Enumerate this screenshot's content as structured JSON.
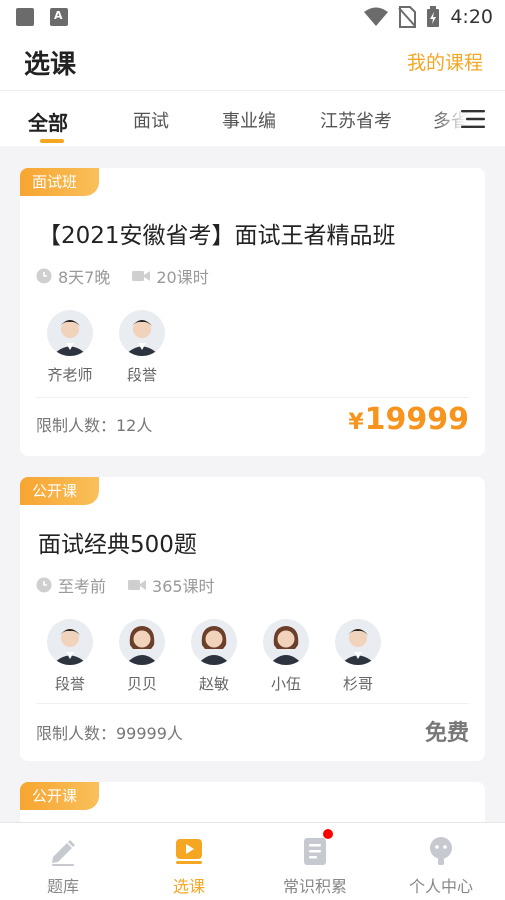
{
  "status_bar": {
    "time": "4:20"
  },
  "header": {
    "title": "选课",
    "my_courses": "我的课程"
  },
  "tabs": [
    "全部",
    "面试",
    "事业编",
    "江苏省考",
    "多省"
  ],
  "courses": [
    {
      "tag": "面试班",
      "title": "【2021安徽省考】面试王者精品班",
      "duration": "8天7晚",
      "lessons": "20课时",
      "teachers": [
        {
          "name": "齐老师",
          "avatar": "male-teacher-avatar"
        },
        {
          "name": "段誉",
          "avatar": "male-teacher-avatar"
        }
      ],
      "limit": "限制人数：12人",
      "price_symbol": "¥",
      "price": "19999"
    },
    {
      "tag": "公开课",
      "title": "面试经典500题",
      "duration": "至考前",
      "lessons": "365课时",
      "teachers": [
        {
          "name": "段誉",
          "avatar": "male-teacher-avatar"
        },
        {
          "name": "贝贝",
          "avatar": "female-teacher-avatar"
        },
        {
          "name": "赵敏",
          "avatar": "female-teacher-avatar"
        },
        {
          "name": "小伍",
          "avatar": "female-teacher-avatar"
        },
        {
          "name": "杉哥",
          "avatar": "male-teacher-avatar"
        }
      ],
      "limit": "限制人数：99999人",
      "price": "免费"
    },
    {
      "tag": "公开课"
    }
  ],
  "bottom_nav": [
    {
      "label": "题库",
      "icon": "pencil-icon",
      "active": false
    },
    {
      "label": "选课",
      "icon": "video-play-icon",
      "active": true
    },
    {
      "label": "常识积累",
      "icon": "notebook-icon",
      "active": false,
      "badge_dot": true
    },
    {
      "label": "个人中心",
      "icon": "profile-icon",
      "active": false
    }
  ],
  "colors": {
    "accent": "#f5a623",
    "price": "#f7941d",
    "badge": "#ff0000"
  }
}
